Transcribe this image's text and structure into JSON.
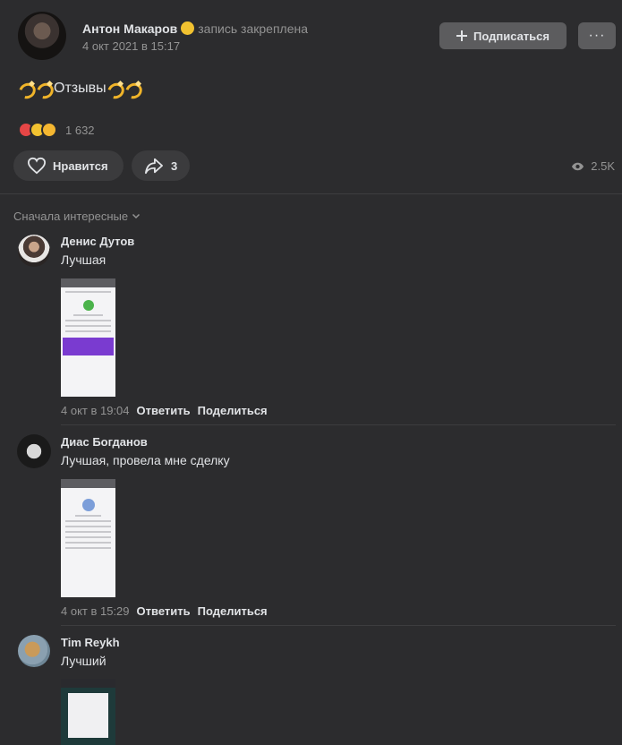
{
  "post": {
    "author": "Антон Макаров",
    "pinned_label": "запись закреплена",
    "date": "4 окт 2021 в 15:17",
    "subscribe_label": "Подписаться",
    "more_label": "···",
    "text": "Отзывы",
    "reactions_count": "1 632",
    "like_label": "Нравится",
    "shares_count": "3",
    "views_count": "2.5K"
  },
  "comments_sort": "Сначала интересные",
  "comments": [
    {
      "author": "Денис Дутов",
      "text": "Лучшая",
      "date": "4 окт в 19:04",
      "reply_label": "Ответить",
      "share_label": "Поделиться"
    },
    {
      "author": "Диас Богданов",
      "text": "Лучшая, провела мне сделку",
      "date": "4 окт в 15:29",
      "reply_label": "Ответить",
      "share_label": "Поделиться"
    },
    {
      "author": "Tim Reykh",
      "text": "Лучший"
    }
  ],
  "colors": {
    "background": "#2c2c2e",
    "text": "#e1e3e6",
    "secondary": "#939393",
    "button": "#5c5c5e"
  }
}
